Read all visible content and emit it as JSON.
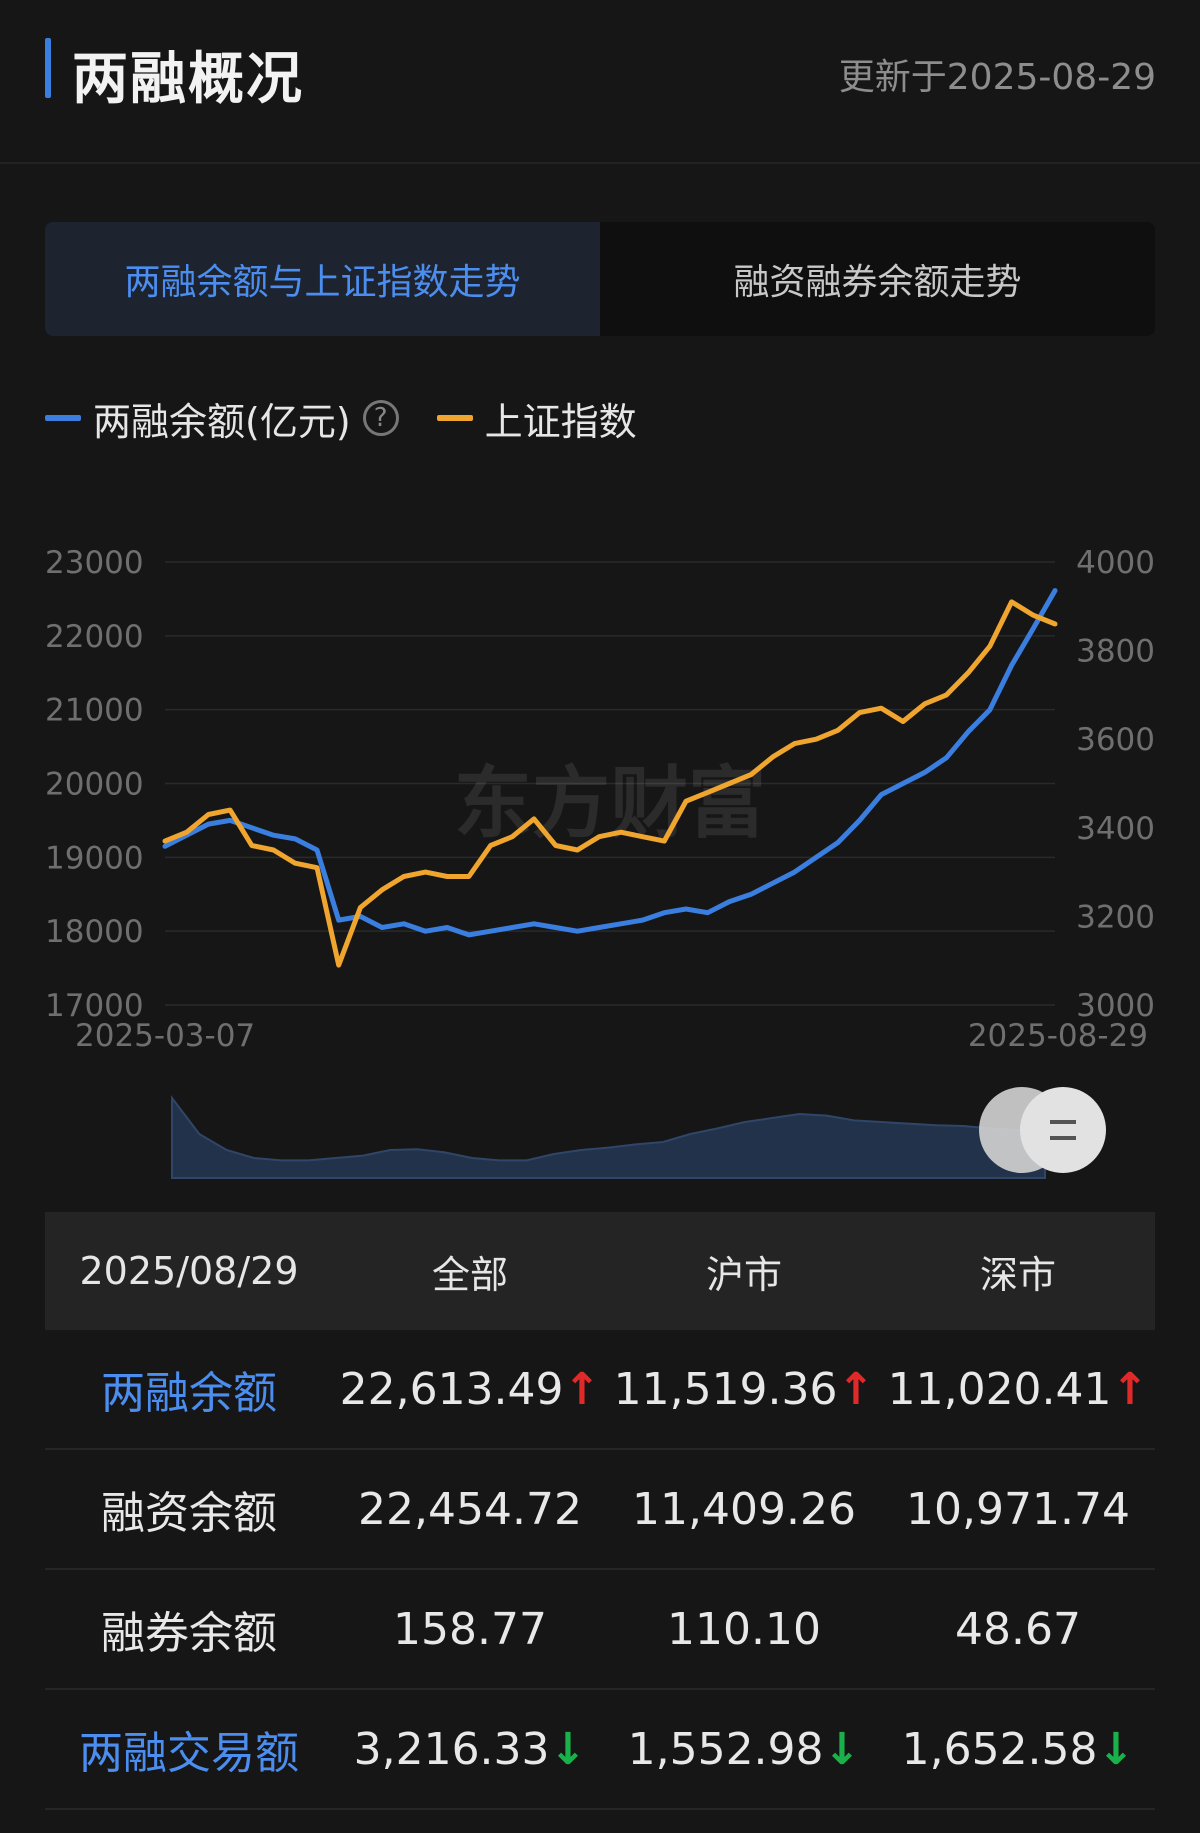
{
  "header": {
    "title": "两融概况",
    "update_time": "更新于2025-08-29"
  },
  "tabs": [
    {
      "label": "两融余额与上证指数走势",
      "active": true
    },
    {
      "label": "融资融券余额走势",
      "active": false
    }
  ],
  "legend": {
    "balance_label": "两融余额(亿元)",
    "index_label": "上证指数",
    "help_icon": "question-circle-icon"
  },
  "colors": {
    "balance": "#3a7ee0",
    "index": "#f0a52e",
    "up": "#e02a2a",
    "down": "#19b24a",
    "accent": "#4c8ef0"
  },
  "chart_data": {
    "type": "line",
    "watermark": "东方财富",
    "x_start": "2025-03-07",
    "x_end": "2025-08-29",
    "left_axis": {
      "ticks": [
        "23000",
        "22000",
        "21000",
        "20000",
        "19000",
        "18000",
        "17000"
      ],
      "range": [
        17000,
        23000
      ]
    },
    "right_axis": {
      "ticks": [
        "4000",
        "3800",
        "3600",
        "3400",
        "3200",
        "3000"
      ],
      "range": [
        3000,
        4000
      ]
    },
    "series": [
      {
        "name": "两融余额(亿元)",
        "axis": "left",
        "values": [
          19150,
          19300,
          19450,
          19500,
          19400,
          19300,
          19250,
          19100,
          18150,
          18200,
          18050,
          18100,
          18000,
          18050,
          17950,
          18000,
          18050,
          18100,
          18050,
          18000,
          18050,
          18100,
          18150,
          18250,
          18300,
          18250,
          18400,
          18500,
          18650,
          18800,
          19000,
          19200,
          19500,
          19850,
          20000,
          20150,
          20350,
          20700,
          21000,
          21600,
          22100,
          22613
        ]
      },
      {
        "name": "上证指数",
        "axis": "right",
        "values": [
          3370,
          3390,
          3430,
          3440,
          3360,
          3350,
          3320,
          3310,
          3090,
          3220,
          3260,
          3290,
          3300,
          3290,
          3290,
          3360,
          3380,
          3420,
          3360,
          3350,
          3380,
          3390,
          3380,
          3370,
          3460,
          3480,
          3500,
          3520,
          3560,
          3590,
          3600,
          3620,
          3660,
          3670,
          3640,
          3680,
          3700,
          3750,
          3810,
          3910,
          3880,
          3860
        ]
      }
    ],
    "overview_values": [
      1.0,
      0.55,
      0.35,
      0.25,
      0.22,
      0.22,
      0.25,
      0.28,
      0.35,
      0.36,
      0.32,
      0.25,
      0.22,
      0.22,
      0.3,
      0.35,
      0.38,
      0.42,
      0.45,
      0.55,
      0.62,
      0.7,
      0.75,
      0.8,
      0.78,
      0.72,
      0.7,
      0.68,
      0.66,
      0.65,
      0.62,
      0.6,
      0.58
    ]
  },
  "table": {
    "date": "2025/08/29",
    "columns": [
      "全部",
      "沪市",
      "深市"
    ],
    "rows": [
      {
        "name": "两融余额",
        "highlight": true,
        "values": [
          "22,613.49",
          "11,519.36",
          "11,020.41"
        ],
        "arrows": [
          "up",
          "up",
          "up"
        ]
      },
      {
        "name": "融资余额",
        "highlight": false,
        "values": [
          "22,454.72",
          "11,409.26",
          "10,971.74"
        ],
        "arrows": [
          "",
          "",
          ""
        ]
      },
      {
        "name": "融券余额",
        "highlight": false,
        "values": [
          "158.77",
          "110.10",
          "48.67"
        ],
        "arrows": [
          "",
          "",
          ""
        ]
      },
      {
        "name": "两融交易额",
        "highlight": true,
        "values": [
          "3,216.33",
          "1,552.98",
          "1,652.58"
        ],
        "arrows": [
          "down",
          "down",
          "down"
        ]
      }
    ]
  }
}
